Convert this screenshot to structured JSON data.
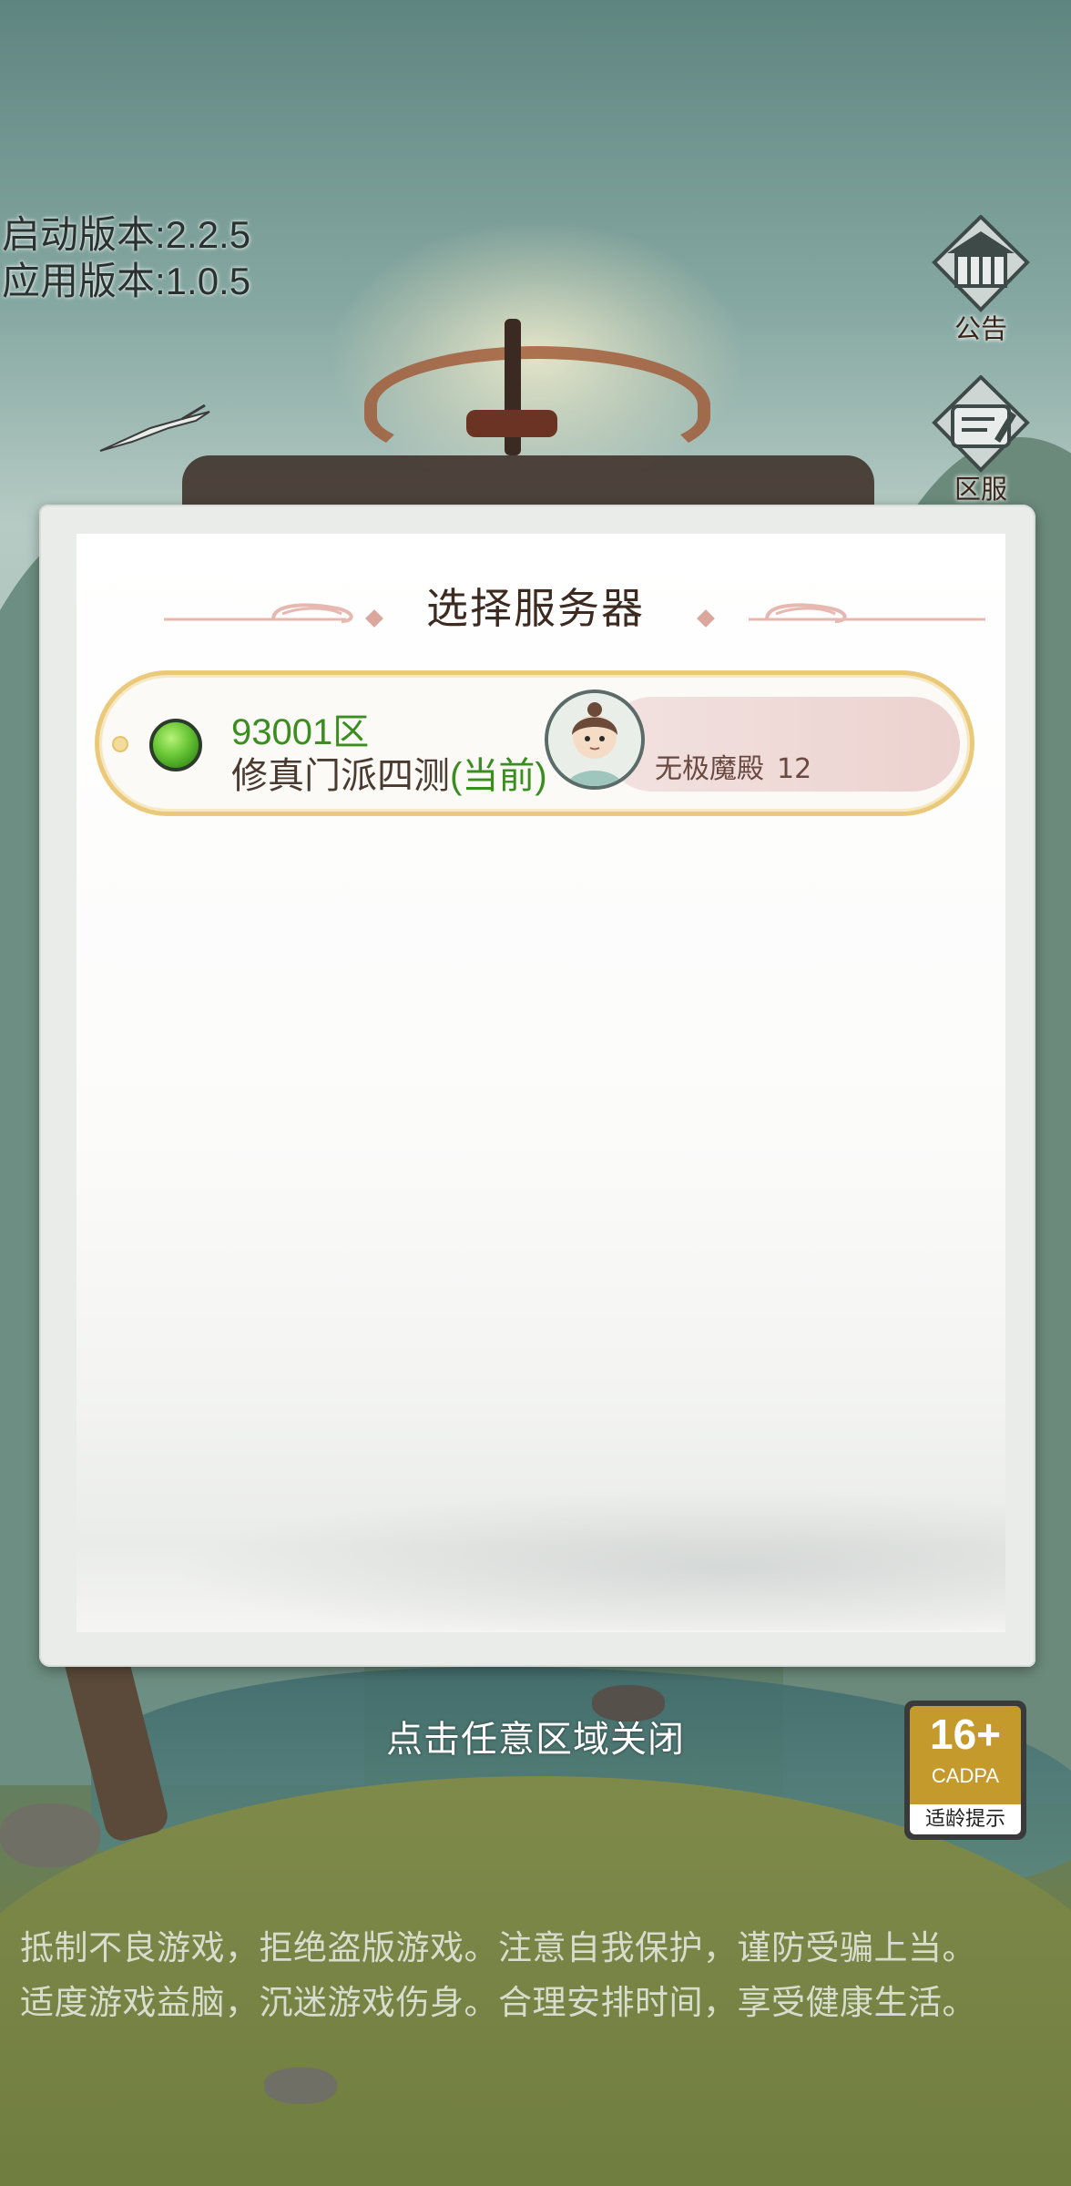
{
  "version": {
    "launcher": "启动版本:2.2.5",
    "app": "应用版本:1.0.5"
  },
  "side_buttons": {
    "notice_label": "公告",
    "server_label": "区服"
  },
  "dialog": {
    "title": "选择服务器",
    "servers": [
      {
        "id": "93001区",
        "name": "修真门派四测",
        "current_tag": "(当前)",
        "status_color": "#6fcb3a",
        "character_name": "无极魔殿",
        "character_level": "12"
      }
    ]
  },
  "close_hint": "点击任意区域关闭",
  "age_rating": {
    "number": "16+",
    "org": "CADPA",
    "tip": "适龄提示"
  },
  "health_notice": {
    "line1": "抵制不良游戏，拒绝盗版游戏。注意自我保护，谨防受骗上当。",
    "line2": "适度游戏益脑，沉迷游戏伤身。合理安排时间，享受健康生活。"
  }
}
